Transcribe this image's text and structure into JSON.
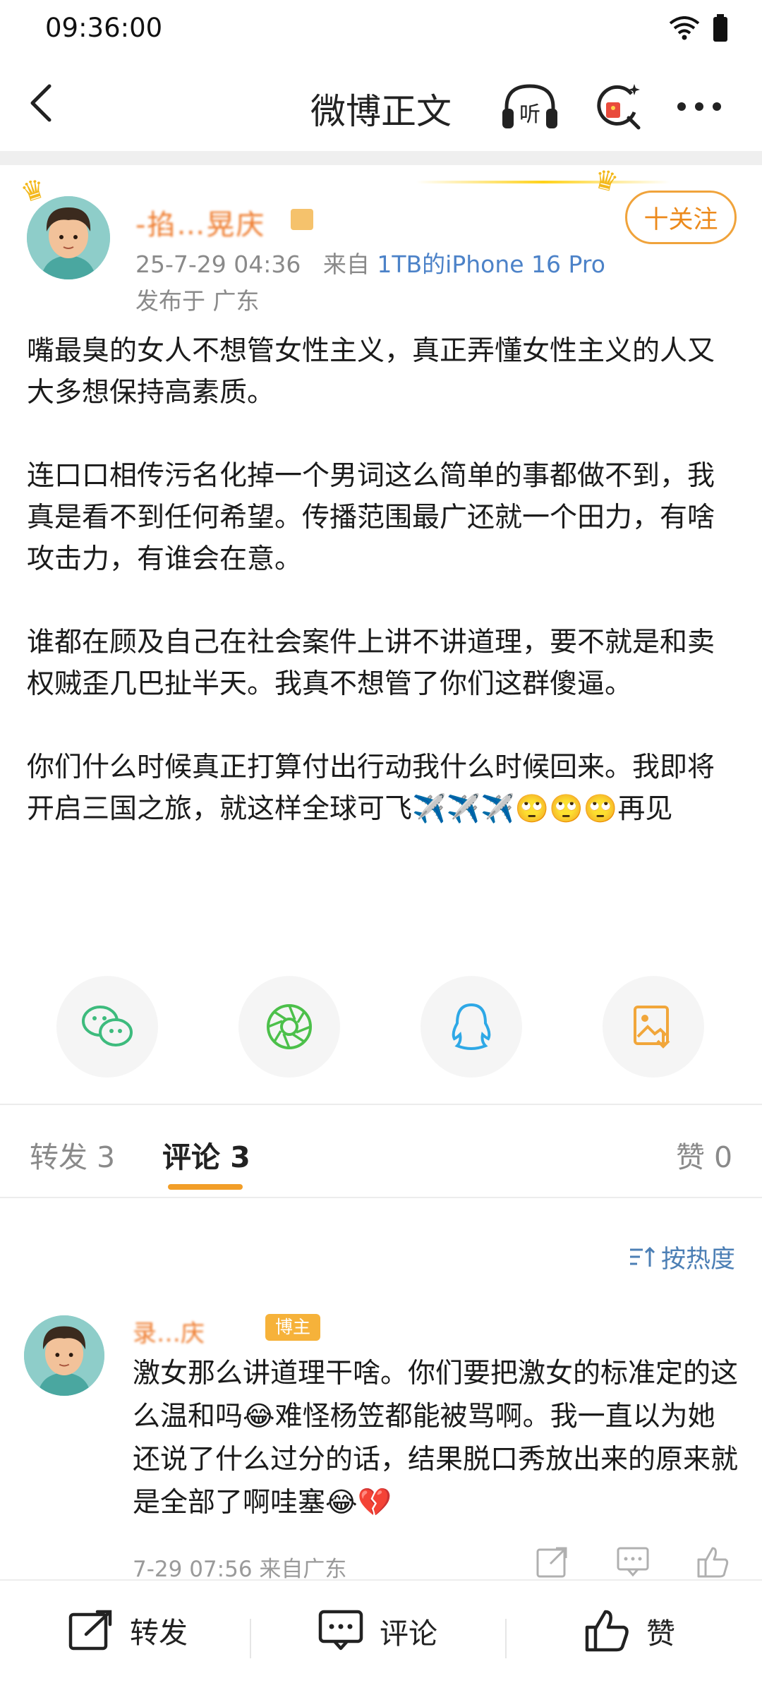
{
  "status_bar": {
    "time": "09:36:00"
  },
  "nav": {
    "title": "微博正文"
  },
  "author": {
    "name": "-掐…晃庆",
    "meta_time": "25-7-29 04:36",
    "meta_from": "来自",
    "device": "1TB的iPhone 16 Pro",
    "location": "发布于 广东",
    "follow_label": "十关注"
  },
  "post": {
    "paragraphs": [
      "嘴最臭的女人不想管女性主义，真正弄懂女性主义的人又大多想保持高素质。",
      "连口口相传污名化掉一个男词这么简单的事都做不到，我真是看不到任何希望。传播范围最广还就一个田力，有啥攻击力，有谁会在意。",
      "谁都在顾及自己在社会案件上讲不讲道理，要不就是和卖权贼歪几巴扯半天。我真不想管了你们这群傻逼。",
      "你们什么时候真正打算付出行动我什么时候回来。我即将开启三国之旅，就这样全球可飞✈️✈️✈️🙄🙄🙄再见"
    ]
  },
  "share": {
    "items": [
      "wechat-icon",
      "moments-icon",
      "qq-icon",
      "save-image-icon"
    ]
  },
  "tabs": {
    "repost": "转发 3",
    "comment": "评论 3",
    "like": "赞 0"
  },
  "sort_label": "按热度",
  "comment": {
    "name": "录…庆",
    "badge": "博主",
    "text": "激女那么讲道理干啥。你们要把激女的标准定的这么温和吗😂难怪杨笠都能被骂啊。我一直以为她还说了什么过分的话，结果脱口秀放出来的原来就是全部了啊哇塞😂💔",
    "meta": "7-29 07:56 来自广东"
  },
  "bottom_bar": {
    "repost": "转发",
    "comment": "评论",
    "like": "赞"
  },
  "colors": {
    "accent": "#f29e28",
    "link": "#4c82c8",
    "name": "#ee7a2b"
  }
}
